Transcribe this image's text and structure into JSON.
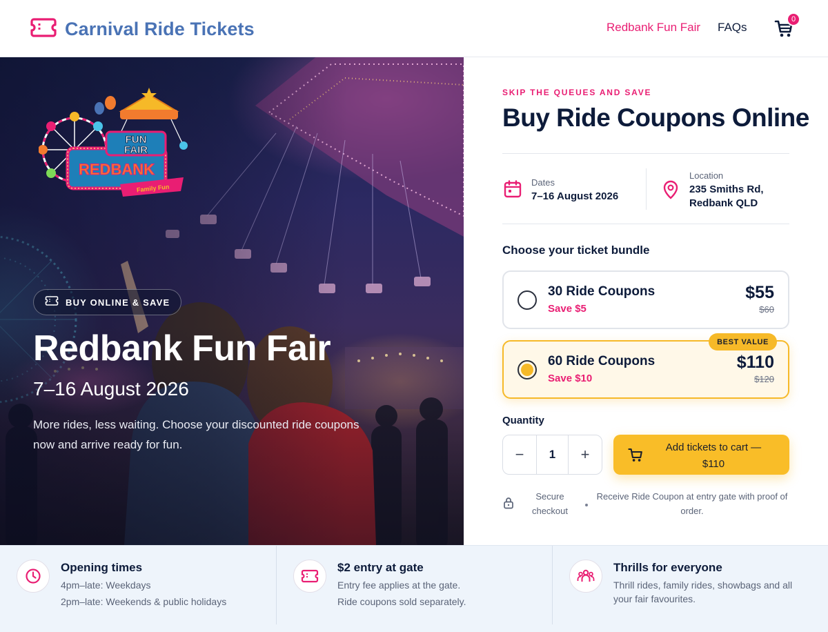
{
  "header": {
    "brand_title": "Carnival Ride Tickets",
    "nav_fair": "Redbank Fun Fair",
    "nav_faqs": "FAQs",
    "cart_count": "0"
  },
  "hero": {
    "logo_line1": "FUN",
    "logo_line2": "FAIR",
    "logo_line3": "REDBANK",
    "logo_ribbon": "Family Fun",
    "pill_text": "BUY ONLINE & SAVE",
    "title": "Redbank Fun Fair",
    "dates": "7–16 August 2026",
    "description": "More rides, less waiting. Choose your discounted ride coupons now and arrive ready for fun."
  },
  "booking": {
    "eyebrow": "SKIP THE QUEUES AND SAVE",
    "title": "Buy Ride Coupons Online",
    "dates_label": "Dates",
    "dates_value": "7–16 August 2026",
    "location_label": "Location",
    "location_line1": "235 Smiths Rd,",
    "location_line2": "Redbank QLD",
    "bundle_heading": "Choose your ticket bundle",
    "bundles": [
      {
        "name": "30 Ride Coupons",
        "save": "Save $5",
        "price": "$55",
        "was": "$60",
        "selected": false
      },
      {
        "name": "60 Ride Coupons",
        "save": "Save $10",
        "price": "$110",
        "was": "$120",
        "selected": true,
        "badge": "BEST VALUE"
      }
    ],
    "quantity_label": "Quantity",
    "quantity_minus": "−",
    "quantity_value": "1",
    "quantity_plus": "+",
    "add_to_cart_line1": "Add tickets to cart —",
    "add_to_cart_line2": "$110",
    "secure_checkout": "Secure checkout",
    "gate_note": "Receive Ride Coupon at entry gate with proof of order."
  },
  "features": [
    {
      "icon": "clock-icon",
      "title": "Opening times",
      "lines": [
        "4pm–late: Weekdays",
        "2pm–late: Weekends & public holidays"
      ]
    },
    {
      "icon": "ticket-icon",
      "title": "$2 entry at gate",
      "lines": [
        "Entry fee applies at the gate.",
        "Ride coupons sold separately."
      ]
    },
    {
      "icon": "people-icon",
      "title": "Thrills for everyone",
      "lines": [
        "Thrill rides, family rides, showbags and all",
        "your fair favourites."
      ]
    }
  ],
  "colors": {
    "brand_blue": "#4a73b5",
    "accent_pink": "#e91e73",
    "accent_yellow": "#f9bd28",
    "navy": "#0d1b3a",
    "feature_bg": "#eef4fb"
  }
}
